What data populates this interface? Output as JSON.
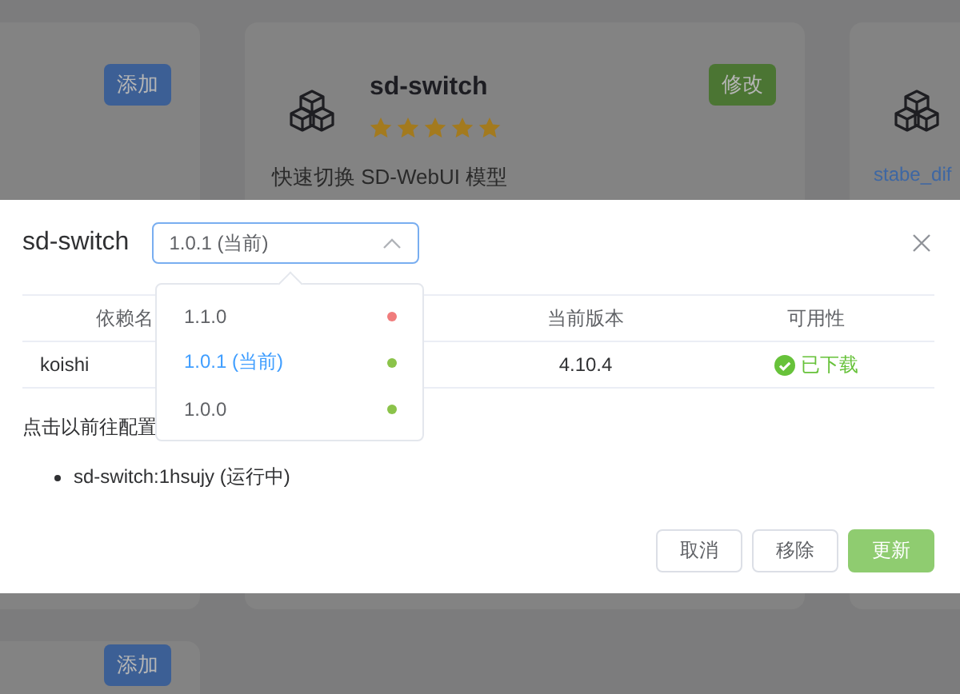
{
  "plugin_cards": [
    {
      "button": {
        "label": "添加",
        "kind": "add"
      }
    },
    {
      "name": "sd-switch",
      "stars": 5,
      "description": "快速切换 SD-WebUI 模型",
      "button": {
        "label": "修改",
        "kind": "edit"
      }
    },
    {
      "link": "stabe_dif"
    },
    {
      "button": {
        "label": "添加",
        "kind": "add"
      }
    }
  ],
  "dialog": {
    "title": "sd-switch",
    "version_select": {
      "value": "1.0.1 (当前)",
      "expanded": true,
      "options": [
        {
          "label": "1.1.0",
          "color": "#f07c7c",
          "selected": false
        },
        {
          "label": "1.0.1 (当前)",
          "color": "#8bc34a",
          "selected": true
        },
        {
          "label": "1.0.0",
          "color": "#8bc34a",
          "selected": false
        }
      ]
    },
    "table": {
      "columns": [
        "依赖名",
        "当前版本",
        "可用性"
      ],
      "rows": [
        {
          "name": "koishi",
          "current": "4.10.4",
          "availability": {
            "label": "已下载",
            "kind": "ok"
          }
        }
      ]
    },
    "note": "点击以前往配置",
    "instances": [
      "sd-switch:1hsujy (运行中)"
    ],
    "buttons": [
      {
        "label": "取消",
        "kind": "plain",
        "disabled": false
      },
      {
        "label": "移除",
        "kind": "plain",
        "disabled": false
      },
      {
        "label": "更新",
        "kind": "primary",
        "disabled": true
      }
    ]
  }
}
